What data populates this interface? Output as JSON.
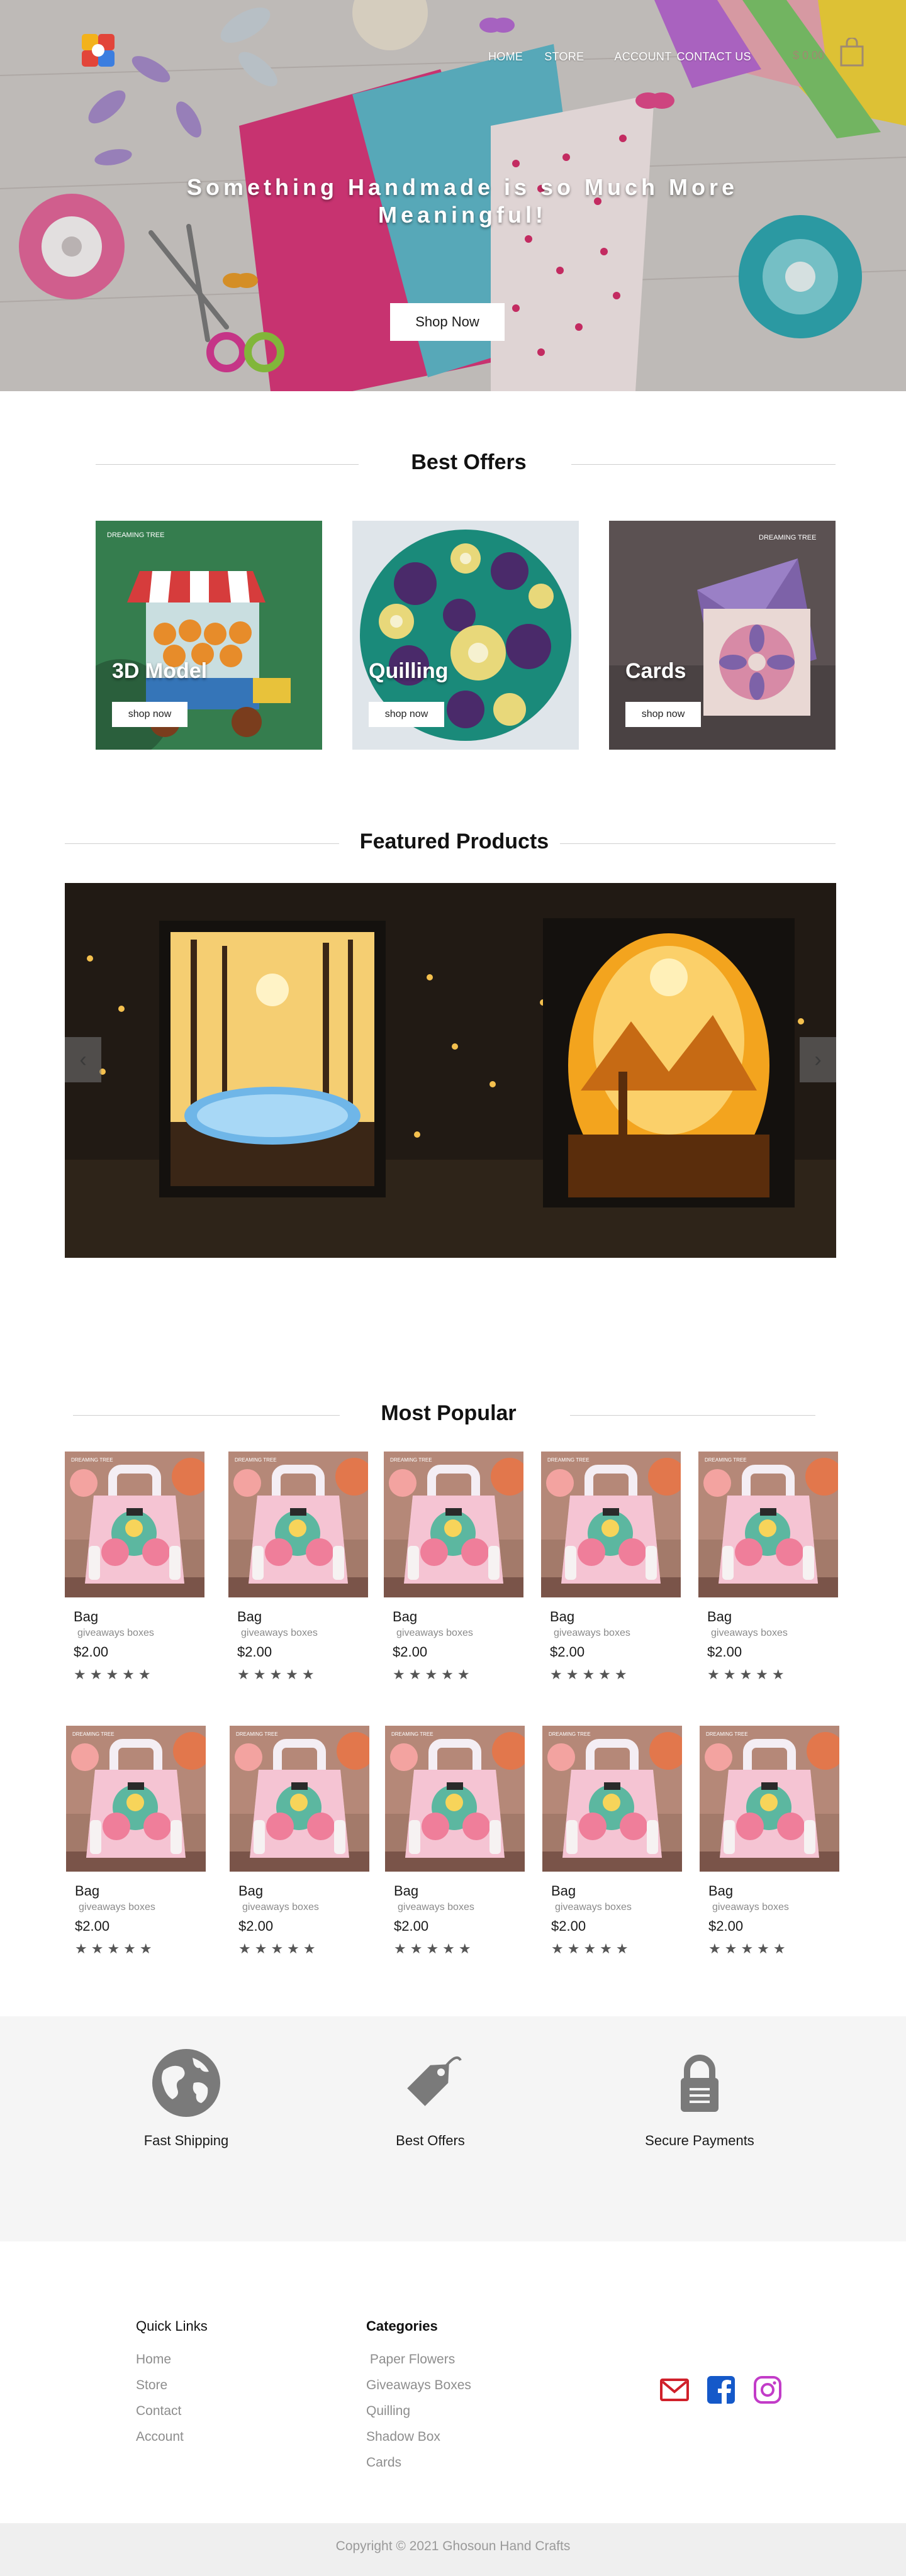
{
  "nav": {
    "items": [
      "HOME",
      "STORE",
      "ACCOUNT",
      "CONTACT US"
    ],
    "cart_total": "$ 0.00"
  },
  "hero": {
    "title": "Something Handmade is so Much More Meaningful!",
    "button": "Shop Now"
  },
  "offers": {
    "title": "Best Offers",
    "items": [
      {
        "label": "3D Model",
        "button": "shop now"
      },
      {
        "label": "Quilling",
        "button": "shop now"
      },
      {
        "label": "Cards",
        "button": "shop now"
      }
    ]
  },
  "featured": {
    "title": "Featured Products",
    "prev_icon": "chevron-left-icon",
    "next_icon": "chevron-right-icon"
  },
  "popular": {
    "title": "Most Popular",
    "products": [
      {
        "name": "Bag",
        "category": "giveaways boxes",
        "price": "$2.00",
        "rating": "★★★★★"
      },
      {
        "name": "Bag",
        "category": "giveaways boxes",
        "price": "$2.00",
        "rating": "★★★★★"
      },
      {
        "name": "Bag",
        "category": "giveaways boxes",
        "price": "$2.00",
        "rating": "★★★★★"
      },
      {
        "name": "Bag",
        "category": "giveaways boxes",
        "price": "$2.00",
        "rating": "★★★★★"
      },
      {
        "name": "Bag",
        "category": "giveaways boxes",
        "price": "$2.00",
        "rating": "★★★★★"
      },
      {
        "name": "Bag",
        "category": "giveaways boxes",
        "price": "$2.00",
        "rating": "★★★★★"
      },
      {
        "name": "Bag",
        "category": "giveaways boxes",
        "price": "$2.00",
        "rating": "★★★★★"
      },
      {
        "name": "Bag",
        "category": "giveaways boxes",
        "price": "$2.00",
        "rating": "★★★★★"
      },
      {
        "name": "Bag",
        "category": "giveaways boxes",
        "price": "$2.00",
        "rating": "★★★★★"
      },
      {
        "name": "Bag",
        "category": "giveaways boxes",
        "price": "$2.00",
        "rating": "★★★★★"
      }
    ]
  },
  "features": [
    {
      "label": "Fast Shipping",
      "icon": "globe-icon"
    },
    {
      "label": "Best  Offers",
      "icon": "price-tag-icon"
    },
    {
      "label": "Secure Payments",
      "icon": "lock-icon"
    }
  ],
  "footer": {
    "quick_links_title": "Quick Links",
    "quick_links": [
      "Home",
      "Store",
      "Contact",
      "Account"
    ],
    "categories_title": "Categories",
    "categories": [
      " Paper Flowers",
      "Giveaways Boxes",
      "Quilling",
      "Shadow Box",
      "Cards"
    ],
    "social": [
      {
        "icon": "email-icon",
        "color": "#d0202a"
      },
      {
        "icon": "facebook-icon",
        "color": "#1559c9"
      },
      {
        "icon": "instagram-icon",
        "color": "#c23cc8"
      }
    ],
    "copyright": "Copyright © 2021 Ghosoun Hand Crafts"
  }
}
